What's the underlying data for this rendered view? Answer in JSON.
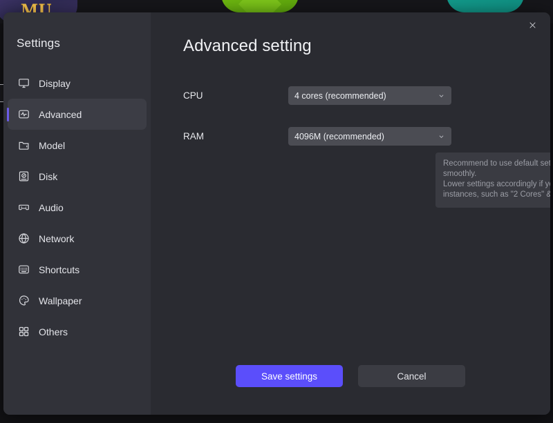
{
  "background": {
    "logo_text": "MU",
    "tiles": [
      "purple-game-tile",
      "green-app-tile",
      "teal-app-tile"
    ]
  },
  "modal": {
    "close_icon": "close-icon",
    "sidebar": {
      "title": "Settings",
      "items": [
        {
          "label": "Display",
          "icon": "monitor-icon",
          "active": false
        },
        {
          "label": "Advanced",
          "icon": "activity-icon",
          "active": true
        },
        {
          "label": "Model",
          "icon": "folder-icon",
          "active": false
        },
        {
          "label": "Disk",
          "icon": "disk-icon",
          "active": false
        },
        {
          "label": "Audio",
          "icon": "gamepad-icon",
          "active": false
        },
        {
          "label": "Network",
          "icon": "globe-icon",
          "active": false
        },
        {
          "label": "Shortcuts",
          "icon": "keyboard-icon",
          "active": false
        },
        {
          "label": "Wallpaper",
          "icon": "palette-icon",
          "active": false
        },
        {
          "label": "Others",
          "icon": "grid-icon",
          "active": false
        }
      ],
      "active_accent_color": "#6c5ce7"
    },
    "content": {
      "title": "Advanced setting",
      "fields": [
        {
          "label": "CPU",
          "value": "4 cores (recommended)",
          "chevron": "chevron-down-icon"
        },
        {
          "label": "RAM",
          "value": "4096M (recommended)",
          "chevron": "chevron-down-icon"
        }
      ],
      "hint_line1": "Recommend to use default settings. Most games run smoothly.",
      "hint_line2": "Lower settings accordingly if you need to open multiple instances, such as \"2 Cores\" & \"2048M\"",
      "save_label": "Save settings",
      "cancel_label": "Cancel",
      "primary_color": "#5b4efb"
    }
  }
}
